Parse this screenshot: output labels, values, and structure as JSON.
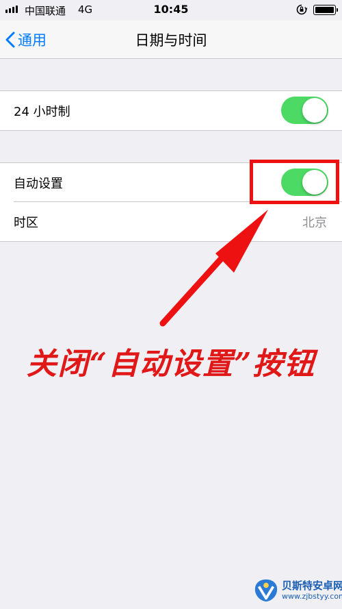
{
  "status_bar": {
    "carrier": "中国联通",
    "network": "4G",
    "time": "10:45",
    "lock_icon": "orientation-lock-icon",
    "battery_icon": "battery-icon"
  },
  "nav": {
    "back_label": "通用",
    "title": "日期与时间"
  },
  "settings": {
    "group1": {
      "label_24h": "24 小时制",
      "toggle_24h_on": true
    },
    "group2": {
      "auto_label": "自动设置",
      "auto_toggle_on": true,
      "timezone_label": "时区",
      "timezone_value": "北京"
    }
  },
  "annotation": {
    "text": "关闭“自动设置”按钮",
    "color": "#e01818"
  },
  "watermark": {
    "name": "贝斯特安卓网",
    "url": "www.zjbstyy.com"
  },
  "colors": {
    "accent": "#007aff",
    "toggle_on": "#4cd964",
    "background": "#efeff4"
  }
}
